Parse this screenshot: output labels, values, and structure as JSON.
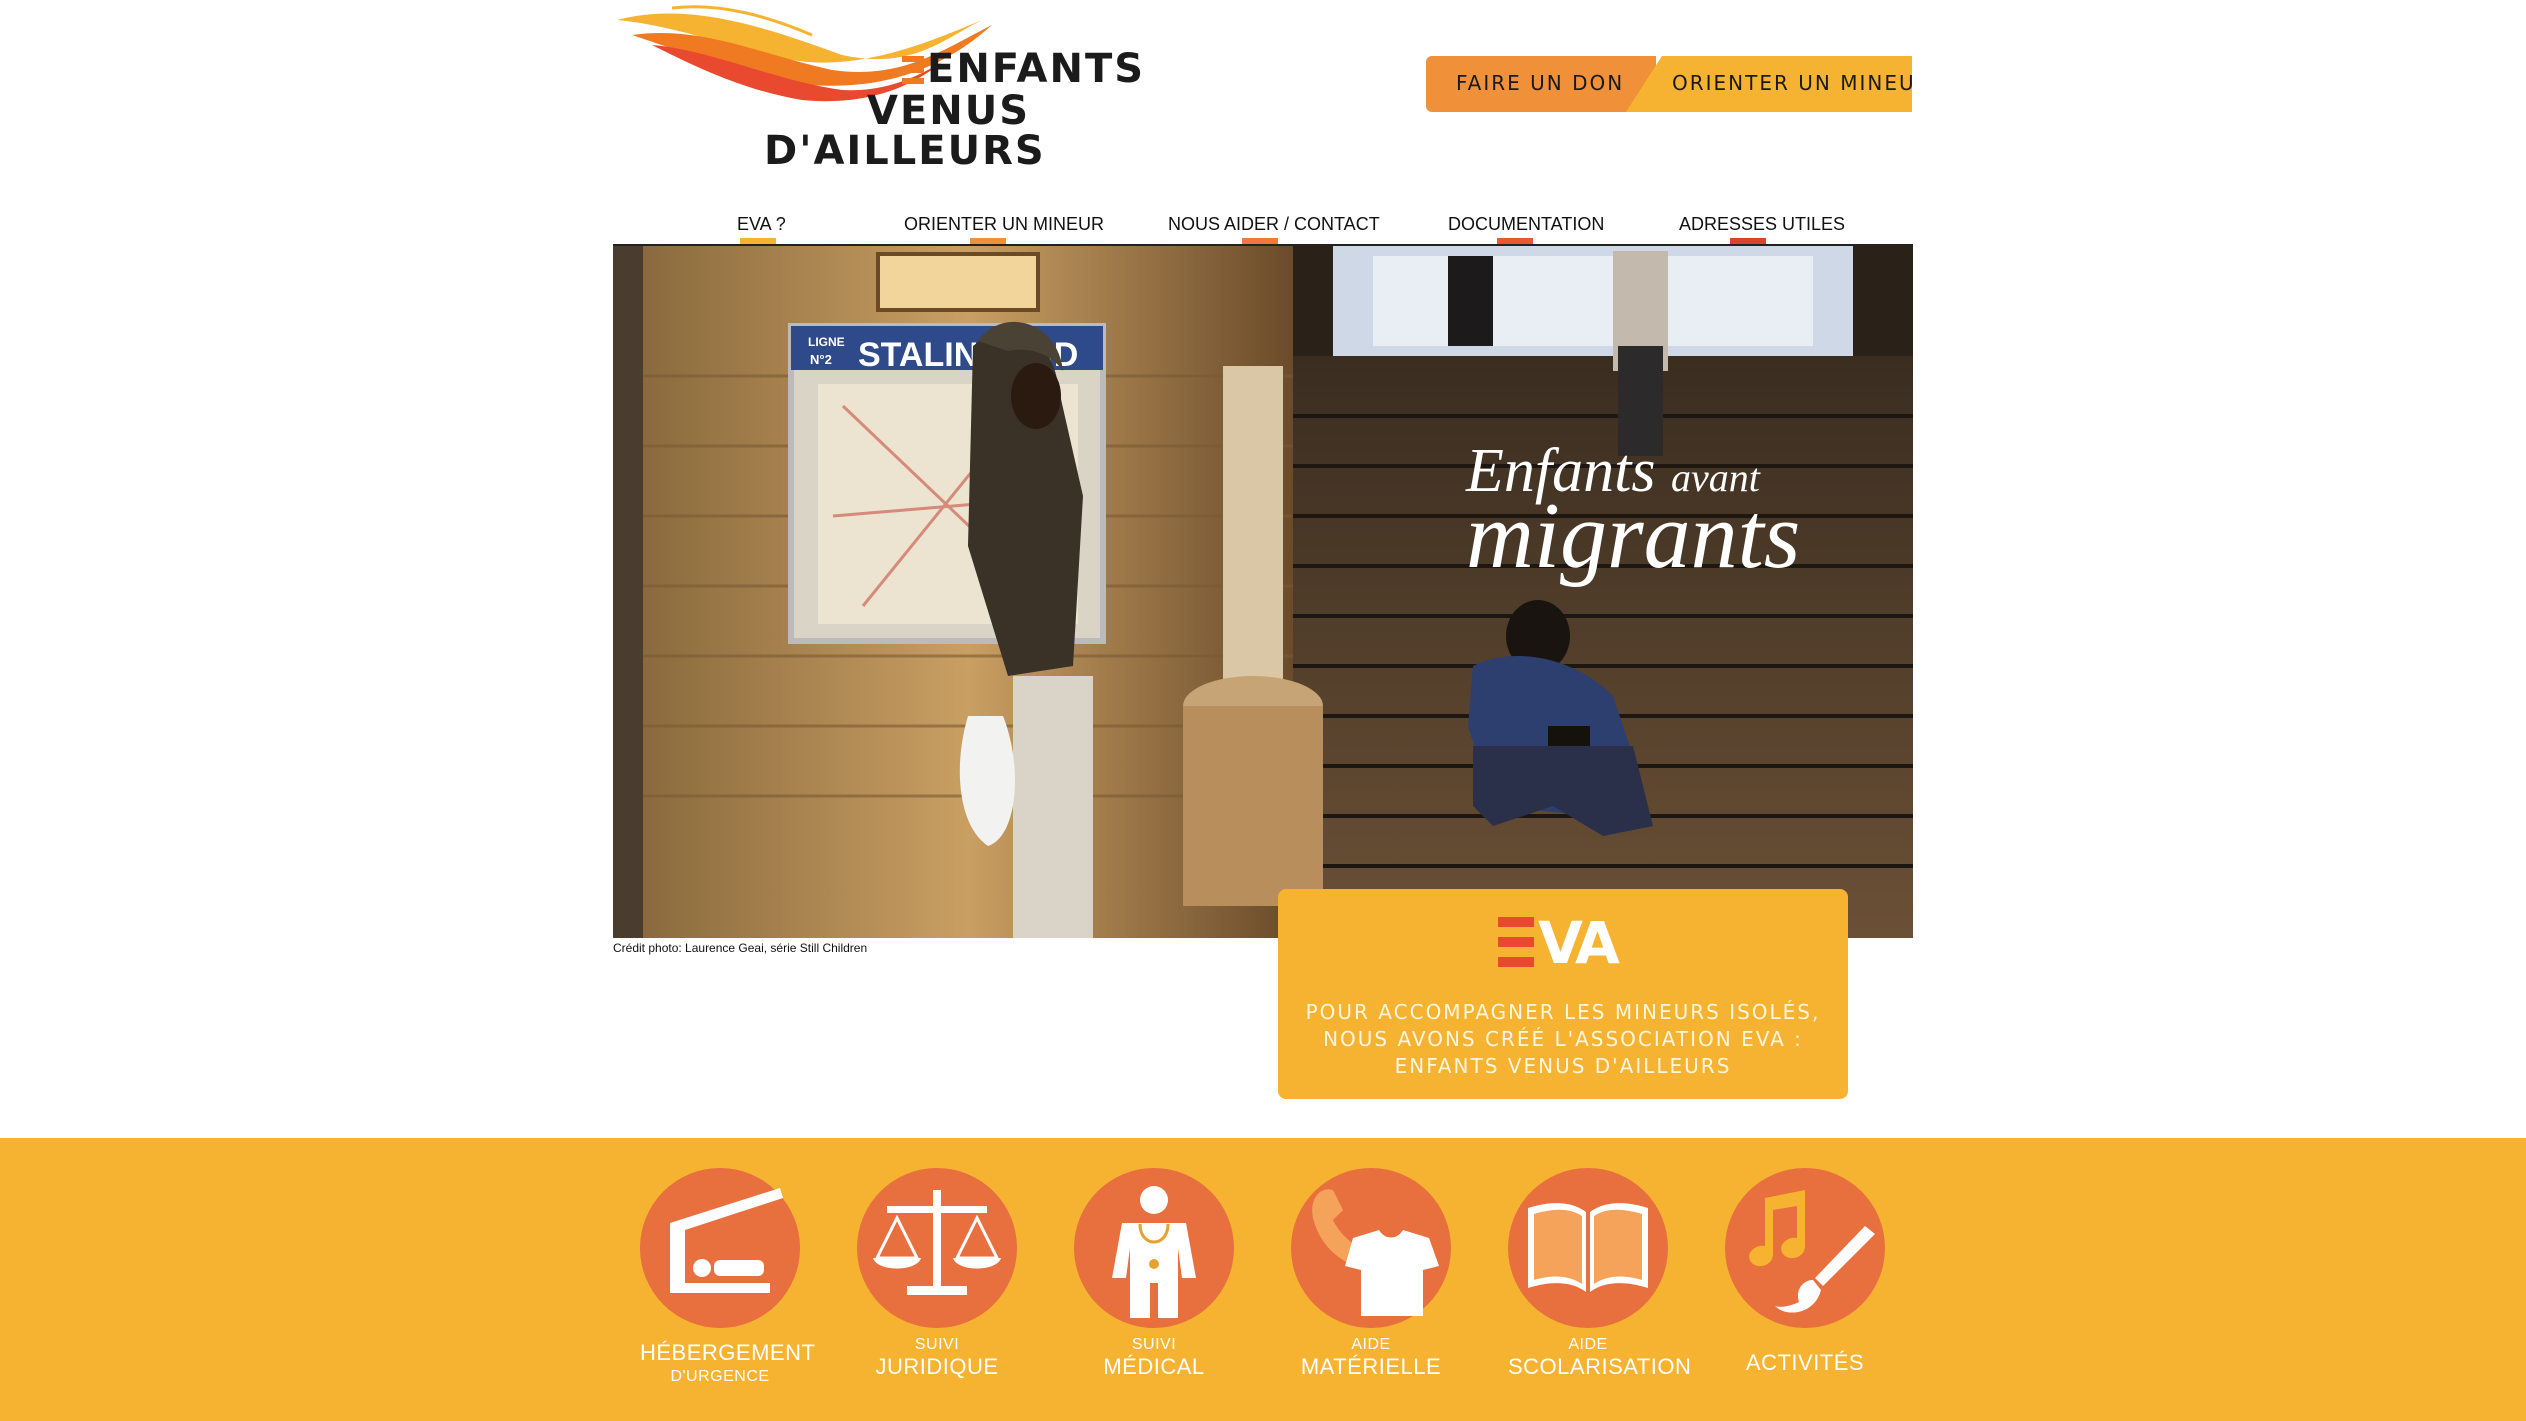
{
  "logo": {
    "line1": "ENFANTS",
    "line2": "VENUS",
    "line3": "D'AILLEURS",
    "brand_colors": [
      "#f07a22",
      "#e8492f",
      "#f6b331"
    ]
  },
  "header_buttons": {
    "donate_label": "FAIRE UN DON",
    "orient_label": "ORIENTER UN MINEUR"
  },
  "nav": {
    "items": [
      {
        "label": "EVA ?",
        "color": "#f6b331"
      },
      {
        "label": "ORIENTER UN MINEUR",
        "color": "#f0913a"
      },
      {
        "label": "NOUS AIDER / CONTACT",
        "color": "#f07a3a"
      },
      {
        "label": "DOCUMENTATION",
        "color": "#e8592f"
      },
      {
        "label": "ADRESSES UTILES",
        "color": "#d9442a"
      }
    ]
  },
  "hero": {
    "sign_line": "LIGNE",
    "sign_no": "N°2",
    "sign_station": "STALINGRAD",
    "tagline_word1": "Enfants",
    "tagline_word2": "avant",
    "tagline_word3": "migrants",
    "photo_credit": "Crédit photo: Laurence Geai, série Still Children"
  },
  "eva_box": {
    "logo_text": "VA",
    "description": "POUR ACCOMPAGNER LES MINEURS ISOLÉS, NOUS AVONS CRÉÉ L'ASSOCIATION EVA : ENFANTS VENUS D'AILLEURS",
    "line1": "POUR ACCOMPAGNER LES MINEURS ISOLÉS,",
    "line2": "NOUS AVONS CRÉÉ L'ASSOCIATION EVA :",
    "line3": "ENFANTS VENUS D'AILLEURS"
  },
  "services": [
    {
      "icon": "shelter-bed-icon",
      "main": "HÉBERGEMENT",
      "sub": "D'URGENCE"
    },
    {
      "icon": "scales-icon",
      "pre": "SUIVI",
      "main": "JURIDIQUE"
    },
    {
      "icon": "doctor-icon",
      "pre": "SUIVI",
      "main": "MÉDICAL"
    },
    {
      "icon": "phone-shirt-icon",
      "pre": "AIDE",
      "main": "MATÉRIELLE"
    },
    {
      "icon": "open-book-icon",
      "pre": "AIDE",
      "main": "SCOLARISATION"
    },
    {
      "icon": "music-brush-icon",
      "main": "ACTIVITÉS"
    }
  ]
}
